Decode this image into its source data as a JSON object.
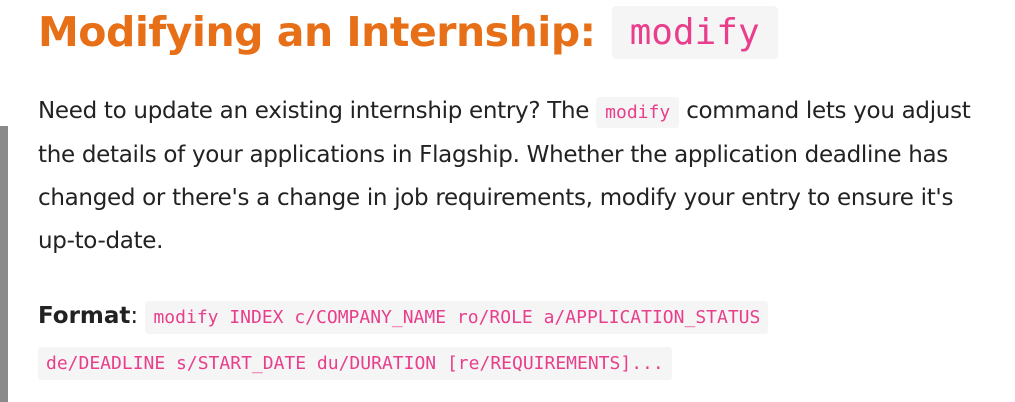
{
  "heading": {
    "text": "Modifying an Internship:",
    "code": "modify"
  },
  "intro": {
    "before_code": "Need to update an existing internship entry? The",
    "code": "modify",
    "after_code": "command lets you adjust the details of your applications in Flagship. Whether the application deadline has changed or there's a change in job requirements, modify your entry to ensure it's up-to-date."
  },
  "format": {
    "label": "Format",
    "separator": ":",
    "code_line1": "modify INDEX c/COMPANY_NAME ro/ROLE a/APPLICATION_STATUS",
    "code_line2": "de/DEADLINE s/START_DATE du/DURATION [re/REQUIREMENTS]..."
  },
  "colors": {
    "heading": "#e76f17",
    "code_text": "#e83e8c",
    "code_background": "#f5f5f5",
    "body_text": "#222222"
  }
}
